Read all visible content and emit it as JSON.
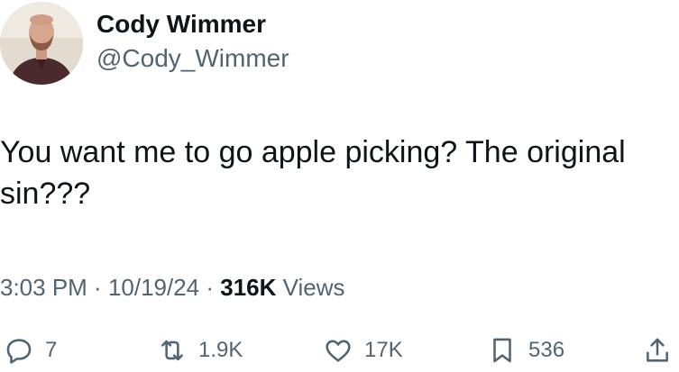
{
  "author": {
    "display_name": "Cody Wimmer",
    "handle": "@Cody_Wimmer"
  },
  "tweet": {
    "text": "You want me to go apple picking? The original sin???"
  },
  "meta": {
    "time": "3:03 PM",
    "sep1": " · ",
    "date": "10/19/24",
    "sep2": " · ",
    "views_count": "316K",
    "views_label": " Views"
  },
  "actions": {
    "replies": "7",
    "reposts": "1.9K",
    "likes": "17K",
    "bookmarks": "536"
  },
  "icons": {
    "reply": "comment-bubble-icon",
    "repost": "retweet-arrows-icon",
    "like": "heart-icon",
    "bookmark": "bookmark-icon",
    "share": "share-upload-icon"
  },
  "colors": {
    "text_primary": "#0f1419",
    "text_secondary": "#536471",
    "background": "#ffffff"
  }
}
